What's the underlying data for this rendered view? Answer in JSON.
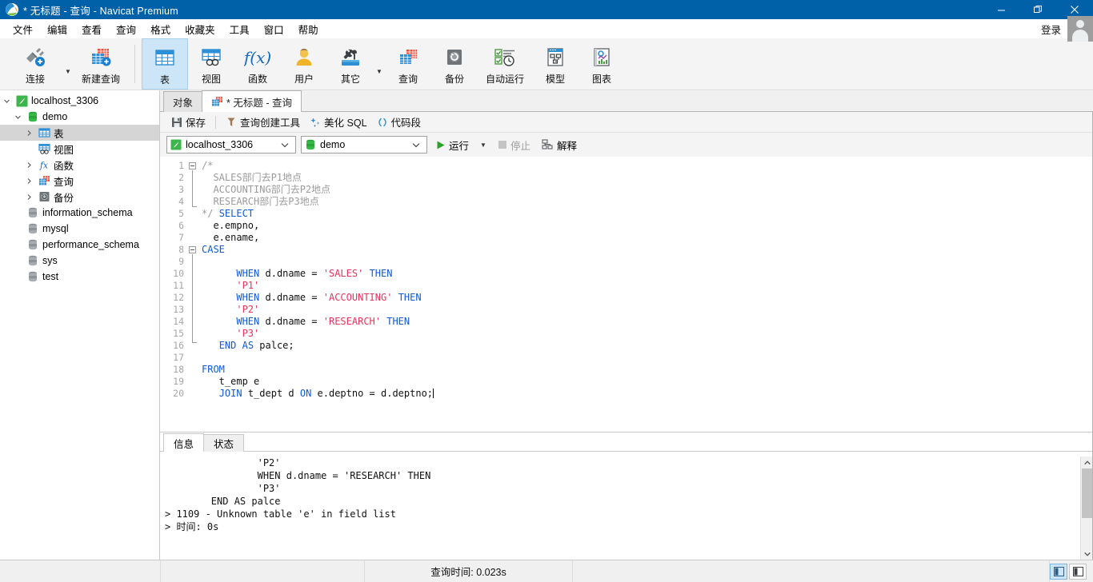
{
  "window": {
    "title_prefix": "* 无标题",
    "title_sep": " - ",
    "title_mid": "查询",
    "title_app": "Navicat Premium",
    "title_full": "* 无标题 - 查询 - Navicat Premium",
    "minimize": "—",
    "maximize": "❐",
    "close": "✕",
    "accent": "#0061a8"
  },
  "menubar": {
    "items": [
      {
        "label": "文件",
        "name": "menu-file"
      },
      {
        "label": "编辑",
        "name": "menu-edit"
      },
      {
        "label": "查看",
        "name": "menu-view"
      },
      {
        "label": "查询",
        "name": "menu-query"
      },
      {
        "label": "格式",
        "name": "menu-format"
      },
      {
        "label": "收藏夹",
        "name": "menu-favorites"
      },
      {
        "label": "工具",
        "name": "menu-tools"
      },
      {
        "label": "窗口",
        "name": "menu-window"
      },
      {
        "label": "帮助",
        "name": "menu-help"
      }
    ],
    "login_label": "登录",
    "avatar_icon": "user-avatar-icon"
  },
  "toolbar": {
    "items": [
      {
        "label": "连接",
        "icon": "connection-icon",
        "has_caret": true
      },
      {
        "label": "新建查询",
        "icon": "new-query-icon",
        "has_caret": false
      },
      {
        "label": "表",
        "icon": "table-icon",
        "active": true
      },
      {
        "label": "视图",
        "icon": "view-icon"
      },
      {
        "label": "函数",
        "icon": "function-icon"
      },
      {
        "label": "用户",
        "icon": "user-icon"
      },
      {
        "label": "其它",
        "icon": "other-tools-icon",
        "has_caret": true
      },
      {
        "label": "查询",
        "icon": "query-icon"
      },
      {
        "label": "备份",
        "icon": "backup-icon"
      },
      {
        "label": "自动运行",
        "icon": "automation-icon"
      },
      {
        "label": "模型",
        "icon": "model-icon"
      },
      {
        "label": "图表",
        "icon": "chart-icon"
      }
    ]
  },
  "sidebar": {
    "nodes": [
      {
        "label": "localhost_3306",
        "icon": "navicat-connection-icon",
        "twist": "expanded",
        "indent": 0,
        "selected": false
      },
      {
        "label": "demo",
        "icon": "database-icon",
        "twist": "expanded",
        "indent": 1,
        "selected": false
      },
      {
        "label": "表",
        "icon": "table-folder-icon",
        "twist": "collapsed",
        "indent": 2,
        "selected": true
      },
      {
        "label": "视图",
        "icon": "view-folder-icon",
        "twist": "none",
        "indent": 2,
        "selected": false
      },
      {
        "label": "函数",
        "icon": "function-folder-icon",
        "twist": "collapsed",
        "indent": 2,
        "selected": false
      },
      {
        "label": "查询",
        "icon": "query-folder-icon",
        "twist": "collapsed",
        "indent": 2,
        "selected": false
      },
      {
        "label": "备份",
        "icon": "backup-folder-icon",
        "twist": "collapsed",
        "indent": 2,
        "selected": false
      },
      {
        "label": "information_schema",
        "icon": "database-icon",
        "twist": "none",
        "indent": 1,
        "selected": false
      },
      {
        "label": "mysql",
        "icon": "database-icon",
        "twist": "none",
        "indent": 1,
        "selected": false
      },
      {
        "label": "performance_schema",
        "icon": "database-icon",
        "twist": "none",
        "indent": 1,
        "selected": false
      },
      {
        "label": "sys",
        "icon": "database-icon",
        "twist": "none",
        "indent": 1,
        "selected": false
      },
      {
        "label": "test",
        "icon": "database-icon",
        "twist": "none",
        "indent": 1,
        "selected": false
      }
    ]
  },
  "tabs": [
    {
      "label": "对象",
      "name": "tab-objects",
      "active": false,
      "icon": "none"
    },
    {
      "label": "* 无标题 - 查询",
      "name": "tab-untitled-query",
      "active": true,
      "icon": "query-tab-icon"
    }
  ],
  "query_toolbar": {
    "save": "保存",
    "save_icon": "save-icon",
    "query_builder": "查询创建工具",
    "query_builder_icon": "query-builder-icon",
    "beautify": "美化 SQL",
    "beautify_icon": "beautify-icon",
    "snippet": "代码段",
    "snippet_icon": "code-snippet-icon"
  },
  "connection_bar": {
    "connection_value": "localhost_3306",
    "connection_icon": "navicat-connection-icon",
    "database_value": "demo",
    "database_icon": "database-icon",
    "run_label": "运行",
    "run_icon": "play-icon",
    "stop_label": "停止",
    "stop_icon": "stop-icon",
    "explain_label": "解释",
    "explain_icon": "explain-icon"
  },
  "editor": {
    "line_numbers": [
      1,
      2,
      3,
      4,
      5,
      6,
      7,
      8,
      9,
      10,
      11,
      12,
      13,
      14,
      15,
      16,
      17,
      18,
      19,
      20
    ],
    "lines": [
      {
        "n": 1,
        "tokens": [
          {
            "t": "cmt",
            "v": "/*"
          }
        ]
      },
      {
        "n": 2,
        "tokens": [
          {
            "t": "cmt",
            "v": "  SALES部门去P1地点"
          }
        ]
      },
      {
        "n": 3,
        "tokens": [
          {
            "t": "cmt",
            "v": "  ACCOUNTING部门去P2地点"
          }
        ]
      },
      {
        "n": 4,
        "tokens": [
          {
            "t": "cmt",
            "v": "  RESEARCH部门去P3地点"
          }
        ]
      },
      {
        "n": 5,
        "tokens": [
          {
            "t": "cmt",
            "v": "*/ "
          },
          {
            "t": "kw",
            "v": "SELECT"
          }
        ]
      },
      {
        "n": 6,
        "tokens": [
          {
            "t": "pln",
            "v": "  e.empno,"
          }
        ]
      },
      {
        "n": 7,
        "tokens": [
          {
            "t": "pln",
            "v": "  e.ename,"
          }
        ]
      },
      {
        "n": 8,
        "tokens": [
          {
            "t": "kw",
            "v": "CASE"
          }
        ]
      },
      {
        "n": 9,
        "tokens": [
          {
            "t": "pln",
            "v": ""
          }
        ]
      },
      {
        "n": 10,
        "tokens": [
          {
            "t": "pln",
            "v": "      "
          },
          {
            "t": "kw",
            "v": "WHEN"
          },
          {
            "t": "pln",
            "v": " d.dname = "
          },
          {
            "t": "str",
            "v": "'SALES'"
          },
          {
            "t": "pln",
            "v": " "
          },
          {
            "t": "kw",
            "v": "THEN"
          }
        ]
      },
      {
        "n": 11,
        "tokens": [
          {
            "t": "pln",
            "v": "      "
          },
          {
            "t": "str",
            "v": "'P1'"
          }
        ]
      },
      {
        "n": 12,
        "tokens": [
          {
            "t": "pln",
            "v": "      "
          },
          {
            "t": "kw",
            "v": "WHEN"
          },
          {
            "t": "pln",
            "v": " d.dname = "
          },
          {
            "t": "str",
            "v": "'ACCOUNTING'"
          },
          {
            "t": "pln",
            "v": " "
          },
          {
            "t": "kw",
            "v": "THEN"
          }
        ]
      },
      {
        "n": 13,
        "tokens": [
          {
            "t": "pln",
            "v": "      "
          },
          {
            "t": "str",
            "v": "'P2'"
          }
        ]
      },
      {
        "n": 14,
        "tokens": [
          {
            "t": "pln",
            "v": "      "
          },
          {
            "t": "kw",
            "v": "WHEN"
          },
          {
            "t": "pln",
            "v": " d.dname = "
          },
          {
            "t": "str",
            "v": "'RESEARCH'"
          },
          {
            "t": "pln",
            "v": " "
          },
          {
            "t": "kw",
            "v": "THEN"
          }
        ]
      },
      {
        "n": 15,
        "tokens": [
          {
            "t": "pln",
            "v": "      "
          },
          {
            "t": "str",
            "v": "'P3'"
          }
        ]
      },
      {
        "n": 16,
        "tokens": [
          {
            "t": "pln",
            "v": "   "
          },
          {
            "t": "kw",
            "v": "END"
          },
          {
            "t": "pln",
            "v": " "
          },
          {
            "t": "kw",
            "v": "AS"
          },
          {
            "t": "pln",
            "v": " palce;"
          }
        ]
      },
      {
        "n": 17,
        "tokens": [
          {
            "t": "pln",
            "v": ""
          }
        ]
      },
      {
        "n": 18,
        "tokens": [
          {
            "t": "kw",
            "v": "FROM"
          }
        ]
      },
      {
        "n": 19,
        "tokens": [
          {
            "t": "pln",
            "v": "   t_emp e"
          }
        ]
      },
      {
        "n": 20,
        "tokens": [
          {
            "t": "pln",
            "v": "   "
          },
          {
            "t": "kw",
            "v": "JOIN"
          },
          {
            "t": "pln",
            "v": " t_dept d "
          },
          {
            "t": "kw",
            "v": "ON"
          },
          {
            "t": "pln",
            "v": " e.deptno = d.deptno;"
          }
        ]
      }
    ]
  },
  "info_panel": {
    "tabs": [
      {
        "label": "信息",
        "name": "tab-message",
        "active": true
      },
      {
        "label": "状态",
        "name": "tab-status",
        "active": false
      }
    ],
    "output": "                'P2'\n                WHEN d.dname = 'RESEARCH' THEN\n                'P3'\n        END AS palce\n> 1109 - Unknown table 'e' in field list\n> 时间: 0s"
  },
  "statusbar": {
    "query_time_label": "查询时间: 0.023s",
    "view_buttons": [
      {
        "name": "split-view-button",
        "active": true
      },
      {
        "name": "single-view-button",
        "active": false
      }
    ]
  }
}
